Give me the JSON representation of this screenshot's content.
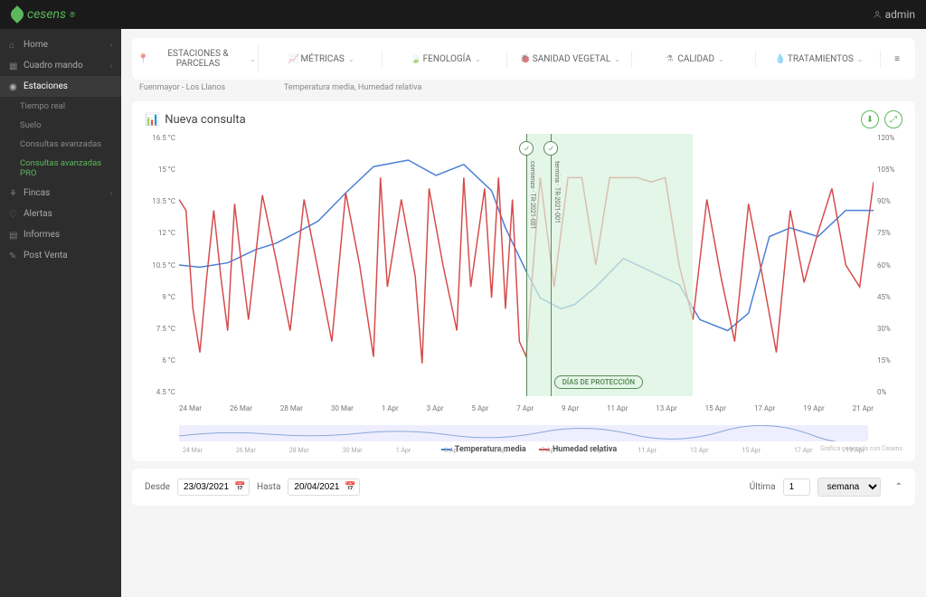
{
  "brand": "cesens",
  "user": "admin",
  "sidebar": {
    "items": [
      {
        "label": "Home"
      },
      {
        "label": "Cuadro mando"
      },
      {
        "label": "Estaciones"
      },
      {
        "label": "Fincas"
      },
      {
        "label": "Alertas"
      },
      {
        "label": "Informes"
      },
      {
        "label": "Post Venta"
      }
    ],
    "subs": [
      {
        "label": "Tiempo real"
      },
      {
        "label": "Suelo"
      },
      {
        "label": "Consultas avanzadas"
      },
      {
        "label": "Consultas avanzadas PRO"
      }
    ]
  },
  "tabs": [
    {
      "label": "ESTACIONES & PARCELAS"
    },
    {
      "label": "MÉTRICAS"
    },
    {
      "label": "FENOLOGÍA"
    },
    {
      "label": "SANIDAD VEGETAL"
    },
    {
      "label": "CALIDAD"
    },
    {
      "label": "TRATAMIENTOS"
    }
  ],
  "sublabels": {
    "left": "Fuenmayor - Los Llanos",
    "right": "Temperatura media, Humedad relativa"
  },
  "card": {
    "title": "Nueva consulta"
  },
  "legend": {
    "a": "Temperatura media",
    "b": "Humedad relativa"
  },
  "badge": "DÍAS DE PROTECCIÓN",
  "markers": [
    "comienzo · TR-2021-001",
    "termina · TR-2021-001"
  ],
  "credit": "Gráfica generada con Cesens",
  "footer": {
    "desde": "Desde",
    "hasta": "Hasta",
    "d1": "23/03/2021",
    "d2": "20/04/2021",
    "ultima": "Última",
    "n": "1",
    "unit": "semana"
  },
  "chart_data": {
    "type": "line",
    "xlabel": "",
    "title": "",
    "x": [
      "24 Mar",
      "26 Mar",
      "28 Mar",
      "30 Mar",
      "1 Apr",
      "3 Apr",
      "5 Apr",
      "7 Apr",
      "9 Apr",
      "11 Apr",
      "13 Apr",
      "15 Apr",
      "17 Apr",
      "19 Apr",
      "21 Apr"
    ],
    "y_left_ticks": [
      "16.5 °C",
      "15 °C",
      "13.5 °C",
      "12 °C",
      "10.5 °C",
      "9 °C",
      "7.5 °C",
      "6 °C",
      "4.5 °C"
    ],
    "y_right_ticks": [
      "120%",
      "105%",
      "90%",
      "75%",
      "60%",
      "45%",
      "30%",
      "15%",
      "0%"
    ],
    "y_left_range": [
      4.5,
      16.5
    ],
    "y_right_range": [
      0,
      120
    ],
    "mini_x": [
      "24 Mar",
      "26 Mar",
      "28 Mar",
      "30 Mar",
      "1 Apr",
      "3 Apr",
      "5 Apr",
      "7 Apr",
      "9 Apr",
      "11 Apr",
      "13 Apr",
      "15 Apr",
      "17 Apr",
      "19 Apr"
    ],
    "series": [
      {
        "name": "Temperatura media",
        "axis": "left",
        "color": "#4a7fd6",
        "x_pct": [
          0,
          3,
          7,
          11,
          14,
          20,
          24,
          28,
          33,
          37,
          41,
          45,
          47,
          50,
          52,
          55,
          57,
          60,
          64,
          68,
          72,
          75,
          79,
          82,
          85,
          88,
          92,
          96,
          100
        ],
        "values": [
          10.5,
          10.4,
          10.6,
          11.2,
          11.5,
          12.5,
          13.8,
          15.0,
          15.3,
          14.6,
          15.1,
          13.9,
          12.2,
          10.2,
          9.0,
          8.5,
          8.7,
          9.5,
          10.8,
          10.2,
          9.6,
          8.0,
          7.5,
          8.3,
          11.8,
          12.2,
          11.8,
          13.0,
          13.0
        ]
      },
      {
        "name": "Humedad relativa",
        "axis": "right",
        "color": "#d64a4a",
        "x_pct": [
          0,
          1,
          2,
          3,
          4,
          5,
          6,
          7,
          8,
          9,
          10,
          12,
          14,
          16,
          18,
          20,
          22,
          24,
          26,
          28,
          29,
          30,
          32,
          34,
          35,
          36,
          38,
          40,
          41,
          42,
          44,
          45,
          46,
          47,
          48,
          49,
          50,
          51,
          52,
          54,
          56,
          58,
          60,
          62,
          64,
          66,
          68,
          70,
          72,
          74,
          76,
          78,
          80,
          82,
          84,
          86,
          88,
          90,
          92,
          94,
          96,
          98,
          100
        ],
        "values": [
          90,
          85,
          40,
          20,
          55,
          85,
          55,
          30,
          88,
          60,
          35,
          92,
          62,
          30,
          90,
          58,
          25,
          93,
          60,
          18,
          100,
          50,
          90,
          55,
          15,
          95,
          60,
          30,
          100,
          50,
          95,
          45,
          100,
          40,
          90,
          25,
          18,
          60,
          100,
          50,
          100,
          100,
          60,
          100,
          100,
          100,
          98,
          100,
          60,
          35,
          90,
          55,
          25,
          88,
          55,
          20,
          85,
          52,
          75,
          95,
          60,
          50,
          98
        ]
      }
    ],
    "shaded": {
      "start_pct": 50,
      "end_pct": 74
    },
    "vlines_pct": [
      50,
      53.5
    ]
  }
}
